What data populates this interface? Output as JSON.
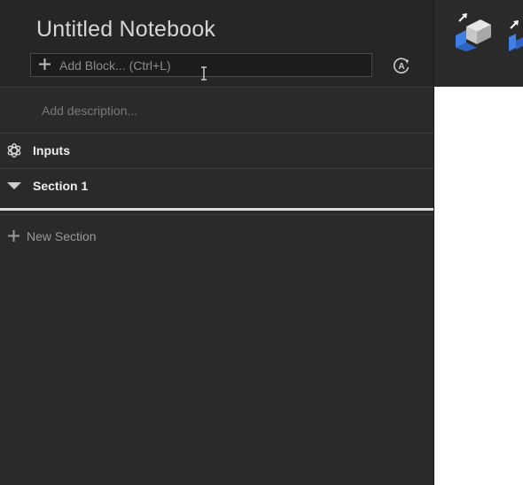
{
  "notebook": {
    "title": "Untitled Notebook",
    "add_block_placeholder": "Add Block... (Ctrl+L)",
    "description_placeholder": "Add description..."
  },
  "rows": [
    {
      "label": "Inputs",
      "icon": "openai-icon"
    },
    {
      "label": "Section 1",
      "icon": "triangle-down-icon"
    }
  ],
  "new_section_label": "New Section",
  "toolbar": {
    "tools": [
      "extrude-block-icon",
      "extrude-profile-icon"
    ]
  },
  "colors": {
    "panel_bg": "#2a2a2a",
    "accent_blue": "#3f7fe6"
  }
}
